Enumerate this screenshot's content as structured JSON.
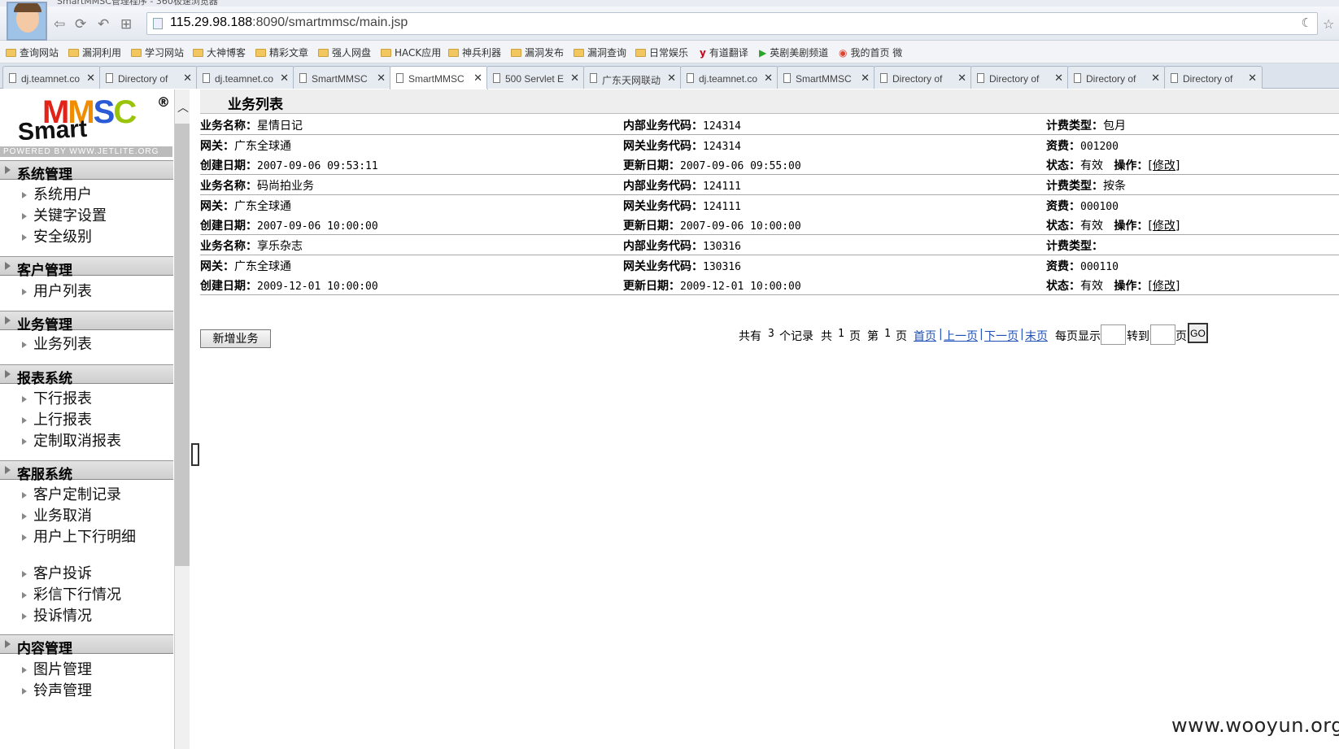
{
  "browser": {
    "window_title": "SmartMMSC管理程序 - 360极速浏览器",
    "address": {
      "host": "115.29.98.188",
      "rest": ":8090/smartmmsc/main.jsp"
    },
    "nav": {
      "back": "⇦",
      "forward": "⟳",
      "undo": "↶",
      "grid": "⊞"
    },
    "bookmarks": [
      {
        "label": "查询网站",
        "icon": "folder-icon"
      },
      {
        "label": "漏洞利用",
        "icon": "folder-icon"
      },
      {
        "label": "学习网站",
        "icon": "folder-icon"
      },
      {
        "label": "大神博客",
        "icon": "folder-icon"
      },
      {
        "label": "精彩文章",
        "icon": "folder-icon"
      },
      {
        "label": "强人网盘",
        "icon": "folder-icon"
      },
      {
        "label": "HACK应用",
        "icon": "folder-icon"
      },
      {
        "label": "神兵利器",
        "icon": "folder-icon"
      },
      {
        "label": "漏洞发布",
        "icon": "folder-icon"
      },
      {
        "label": "漏洞查询",
        "icon": "folder-icon"
      },
      {
        "label": "日常娱乐",
        "icon": "folder-icon"
      },
      {
        "label": "有道翻译",
        "icon": "youdao-icon"
      },
      {
        "label": "英剧美剧频道",
        "icon": "play-icon"
      },
      {
        "label": "我的首页 微",
        "icon": "weibo-icon"
      }
    ],
    "tabs": [
      {
        "label": "dj.teamnet.co",
        "active": false
      },
      {
        "label": "Directory of",
        "active": false
      },
      {
        "label": "dj.teamnet.co",
        "active": false
      },
      {
        "label": "SmartMMSC",
        "active": false
      },
      {
        "label": "SmartMMSC",
        "active": true
      },
      {
        "label": "500 Servlet E",
        "active": false
      },
      {
        "label": "广东天网联动",
        "active": false
      },
      {
        "label": "dj.teamnet.co",
        "active": false
      },
      {
        "label": "SmartMMSC",
        "active": false
      },
      {
        "label": "Directory of",
        "active": false
      },
      {
        "label": "Directory of",
        "active": false
      },
      {
        "label": "Directory of",
        "active": false
      },
      {
        "label": "Directory of",
        "active": false
      }
    ]
  },
  "logo": {
    "text_mmsc": [
      "M",
      "M",
      "S",
      "C"
    ],
    "smart": "Smart",
    "reg": "®",
    "powered": "POWERED BY WWW.JETLITE.ORG"
  },
  "sidebar": {
    "sections": [
      {
        "title": "系统管理",
        "items": [
          "系统用户",
          "关键字设置",
          "安全级别"
        ]
      },
      {
        "title": "客户管理",
        "items": [
          "用户列表"
        ]
      },
      {
        "title": "业务管理",
        "items": [
          "业务列表"
        ]
      },
      {
        "title": "报表系统",
        "items": [
          "下行报表",
          "上行报表",
          "定制取消报表"
        ]
      },
      {
        "title": "客服系统",
        "items": [
          "客户定制记录",
          "业务取消",
          "用户上下行明细",
          "客户投诉",
          "彩信下行情况",
          "投诉情况"
        ]
      },
      {
        "title": "内容管理",
        "items": [
          "图片管理",
          "铃声管理"
        ]
      }
    ]
  },
  "main": {
    "title": "业务列表",
    "labels": {
      "name": "业务名称：",
      "internal_code": "内部业务代码：",
      "billing_type": "计费类型：",
      "gateway": "网关：",
      "gateway_code": "网关业务代码：",
      "fee": "资费：",
      "created": "创建日期：",
      "updated": "更新日期：",
      "status": "状态：",
      "ops": "操作：",
      "modify": "[修改]"
    },
    "records": [
      {
        "name": "星情日记",
        "internal_code": "124314",
        "billing_type": "包月",
        "gateway": "广东全球通",
        "gateway_code": "124314",
        "fee": "001200",
        "created": "2007-09-06 09:53:11",
        "updated": "2007-09-06 09:55:00",
        "status": "有效"
      },
      {
        "name": "码尚拍业务",
        "internal_code": "124111",
        "billing_type": "按条",
        "gateway": "广东全球通",
        "gateway_code": "124111",
        "fee": "000100",
        "created": "2007-09-06 10:00:00",
        "updated": "2007-09-06 10:00:00",
        "status": "有效"
      },
      {
        "name": "享乐杂志",
        "internal_code": "130316",
        "billing_type": "",
        "gateway": "广东全球通",
        "gateway_code": "130316",
        "fee": "000110",
        "created": "2009-12-01 10:00:00",
        "updated": "2009-12-01 10:00:00",
        "status": "有效"
      }
    ],
    "add_button": "新增业务",
    "pager": {
      "total_prefix": "共有",
      "total_records": "3",
      "total_suffix": "个记录",
      "pages_prefix": "共",
      "pages": "1",
      "pages_suffix": "页",
      "page_prefix": "第",
      "page": "1",
      "page_suffix": "页",
      "first": "首页",
      "prev": "上一页",
      "next": "下一页",
      "last": "末页",
      "per_page": "每页显示",
      "goto": "转到",
      "page_unit": "页",
      "go": "GO"
    }
  },
  "watermark": "www.wooyun.org"
}
